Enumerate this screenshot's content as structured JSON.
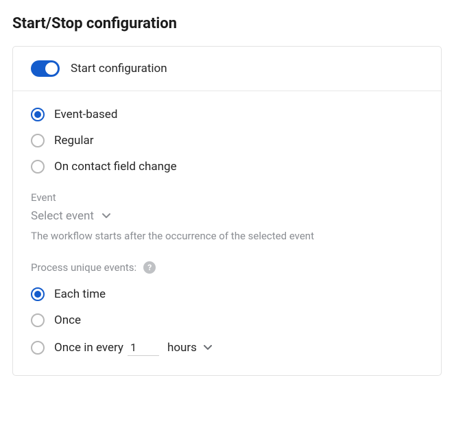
{
  "page_title": "Start/Stop configuration",
  "toggle": {
    "label": "Start configuration",
    "on": true
  },
  "trigger_type": {
    "options": [
      {
        "label": "Event-based",
        "selected": true
      },
      {
        "label": "Regular",
        "selected": false
      },
      {
        "label": "On contact field change",
        "selected": false
      }
    ]
  },
  "event": {
    "label": "Event",
    "placeholder": "Select event",
    "help": "The workflow starts after the occurrence of the selected event"
  },
  "unique": {
    "label": "Process unique events:",
    "options": [
      {
        "label": "Each time",
        "selected": true
      },
      {
        "label": "Once",
        "selected": false
      },
      {
        "label_prefix": "Once in every",
        "selected": false
      }
    ],
    "interval_value": "1",
    "interval_unit": "hours"
  }
}
